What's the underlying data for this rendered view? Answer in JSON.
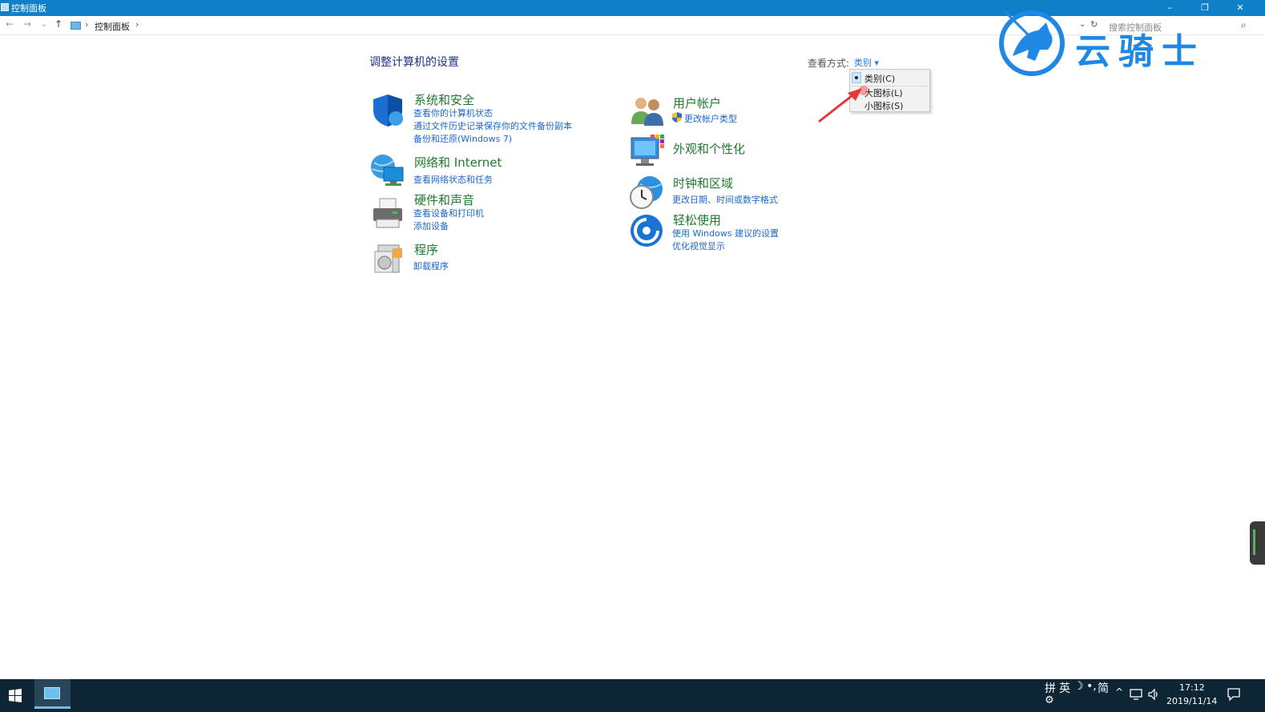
{
  "window": {
    "title": "控制面板",
    "minimize": "–",
    "restore": "❐",
    "close": "✕"
  },
  "address": {
    "back": "←",
    "forward": "→",
    "recent": "⌄",
    "up": "↑",
    "sep1": "›",
    "crumb": "控制面板",
    "sep2": "›",
    "dropdown": "⌄",
    "refresh": "↻",
    "search_placeholder": "搜索控制面板",
    "search_icon": "⌕"
  },
  "logo": {
    "text": "云骑士"
  },
  "main": {
    "title": "调整计算机的设置",
    "viewby_label": "查看方式:",
    "viewby_value": "类别 ▾"
  },
  "categories": {
    "system": {
      "title": "系统和安全",
      "links": [
        "查看你的计算机状态",
        "通过文件历史记录保存你的文件备份副本",
        "备份和还原(Windows 7)"
      ]
    },
    "network": {
      "title": "网络和 Internet",
      "links": [
        "查看网络状态和任务"
      ]
    },
    "hardware": {
      "title": "硬件和声音",
      "links": [
        "查看设备和打印机",
        "添加设备"
      ]
    },
    "programs": {
      "title": "程序",
      "links": [
        "卸载程序"
      ]
    },
    "users": {
      "title": "用户帐户",
      "links": [
        "更改帐户类型"
      ]
    },
    "appearance": {
      "title": "外观和个性化",
      "links": []
    },
    "clock": {
      "title": "时钟和区域",
      "links": [
        "更改日期、时间或数字格式"
      ]
    },
    "ease": {
      "title": "轻松使用",
      "links": [
        "使用 Windows 建议的设置",
        "优化视觉显示"
      ]
    }
  },
  "dropdown": {
    "items": [
      "类别(C)",
      "大图标(L)",
      "小图标(S)"
    ],
    "selected": "类别(C)"
  },
  "taskbar": {
    "ime_1": "拼",
    "ime_2": "英",
    "ime_3": "☽",
    "ime_4": "•,",
    "ime_5": "简",
    "ime_settings": "⚙",
    "tray_up": "^",
    "time": "17:12",
    "date": "2019/11/14",
    "notification": "▭"
  },
  "colors": {
    "titlebar": "#0f80c8",
    "link": "#1c68c7",
    "category_title": "#1e7a2e",
    "page_title": "#1e3287",
    "taskbar": "#0e2536",
    "logo": "#1f88e5"
  }
}
